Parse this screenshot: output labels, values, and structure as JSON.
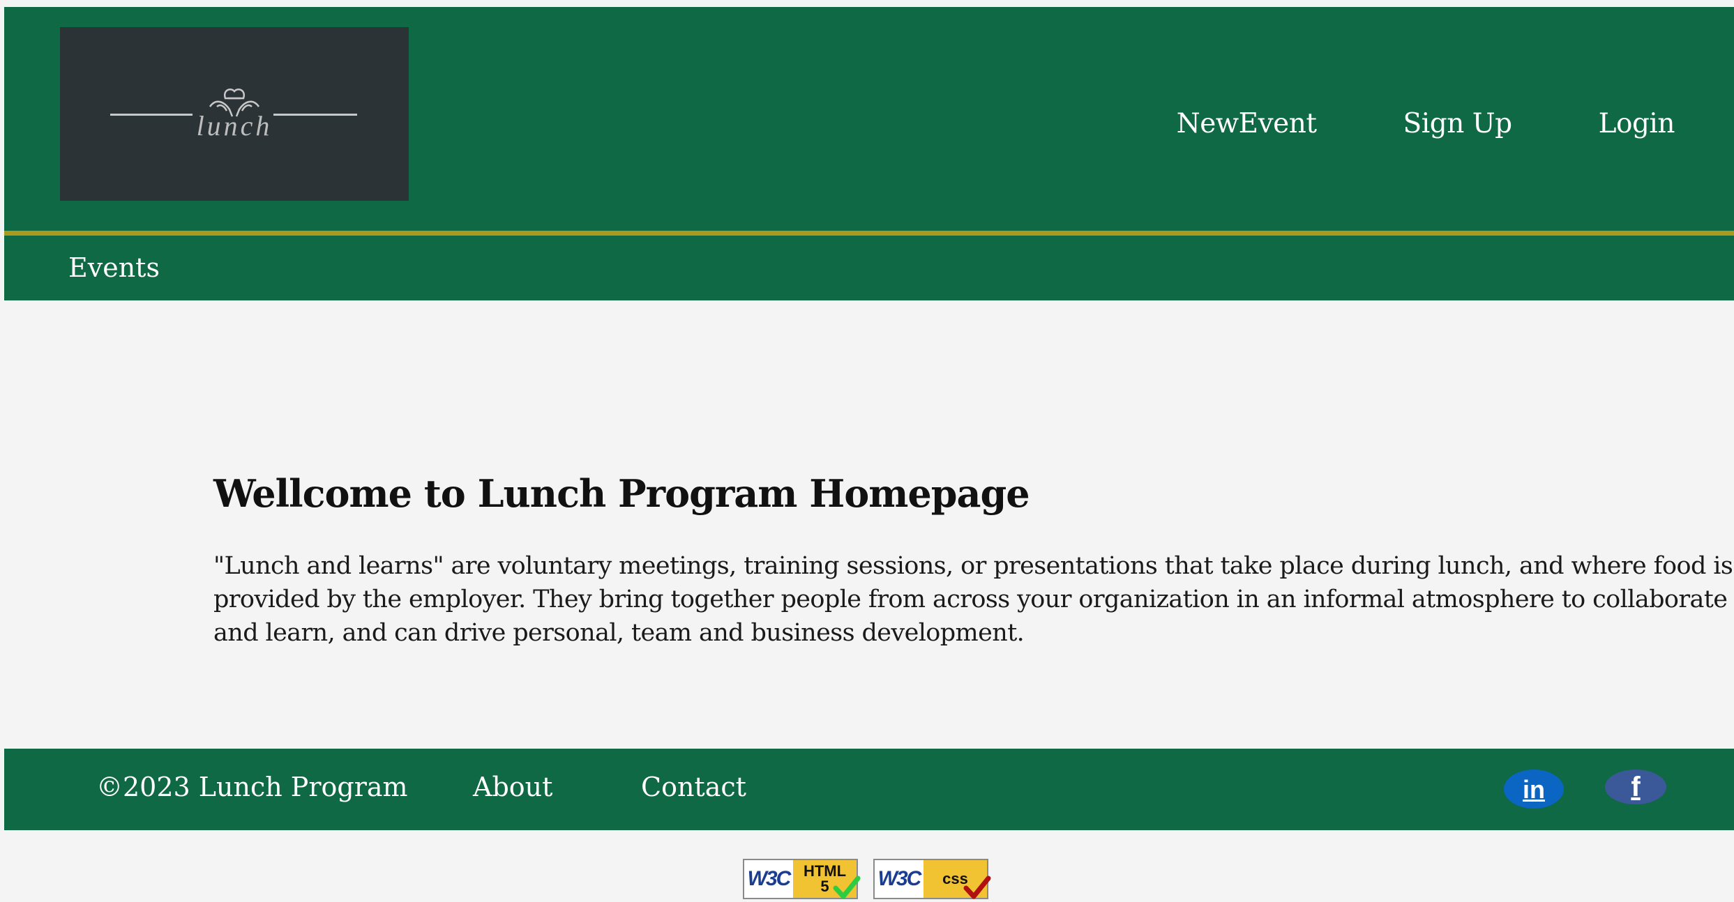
{
  "header": {
    "logo": {
      "text": "lunch",
      "icon": "chef-hands-icon"
    },
    "nav": [
      {
        "label": "NewEvent"
      },
      {
        "label": "Sign Up"
      },
      {
        "label": "Login"
      }
    ]
  },
  "subnav": {
    "events_label": "Events"
  },
  "main": {
    "title": "Wellcome to Lunch Program Homepage",
    "paragraph": "\"Lunch and learns\" are voluntary meetings, training sessions, or presentations that take place during lunch, and where food is provided by the employer. They bring together people from across your organization in an informal atmosphere to collaborate and learn, and can drive personal, team and business development."
  },
  "footer": {
    "copyright": "©2023 Lunch Program",
    "links": [
      {
        "label": "About"
      },
      {
        "label": "Contact"
      }
    ],
    "social": [
      {
        "name": "linkedin-icon",
        "glyph": "in"
      },
      {
        "name": "facebook-icon",
        "glyph": "f"
      }
    ]
  },
  "badges": [
    {
      "org": "W3C",
      "kind_line1": "HTML",
      "kind_line2": "5",
      "check_color": "#2ecc40"
    },
    {
      "org": "W3C",
      "kind_line1": "css",
      "kind_line2": "",
      "check_color": "#b01010"
    }
  ],
  "colors": {
    "brand_green": "#0f6944",
    "accent_gold": "#a89a1c",
    "background": "#f4f4f4",
    "logo_bg": "#2c3336"
  }
}
